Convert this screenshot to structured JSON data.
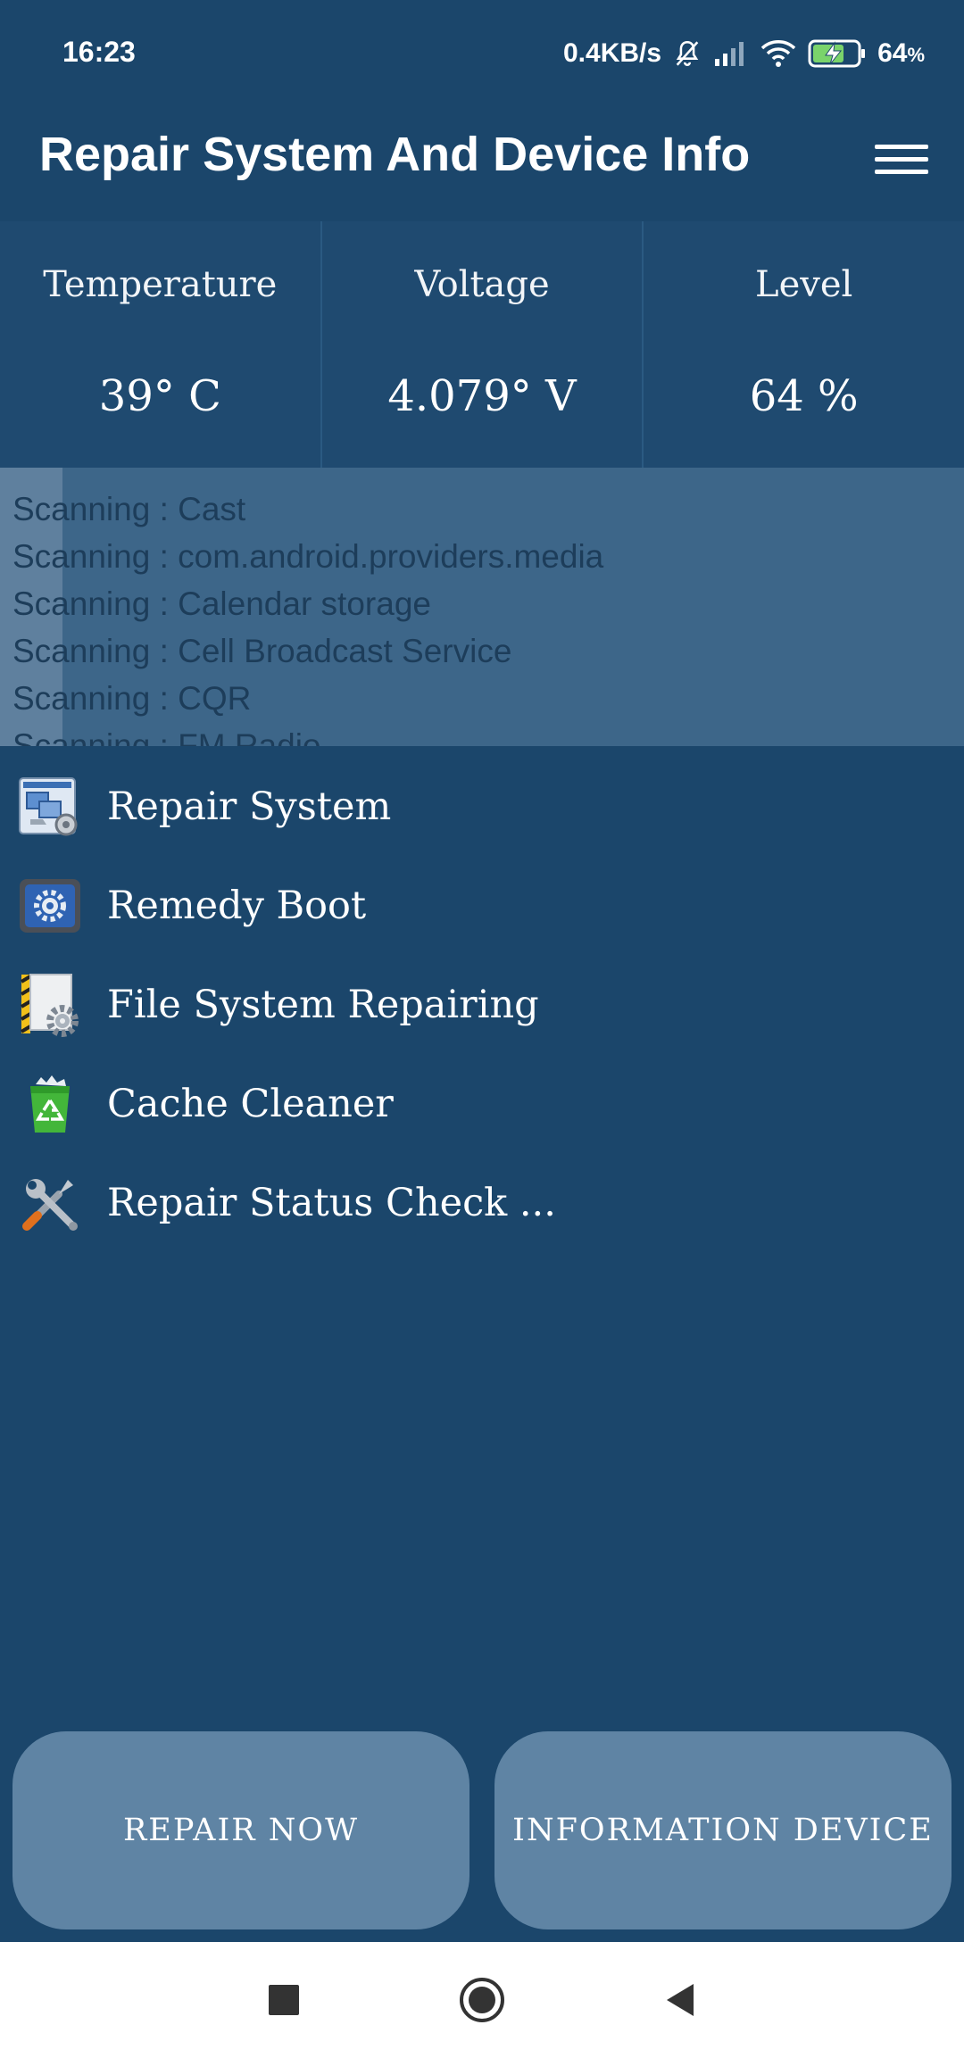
{
  "status_bar": {
    "time": "16:23",
    "net_speed": "0.4KB/s",
    "battery_percent": "64",
    "battery_unit": "%",
    "icons": [
      "bell-off-icon",
      "signal-icon",
      "wifi-icon",
      "battery-charging-icon"
    ]
  },
  "app_bar": {
    "title": "Repair System And Device Info",
    "menu_icon": "hamburger-menu-icon"
  },
  "stats": {
    "temperature": {
      "label": "Temperature",
      "value": "39° C"
    },
    "voltage": {
      "label": "Voltage",
      "value": "4.079° V"
    },
    "level": {
      "label": "Level",
      "value": "64 %"
    }
  },
  "scan_log": {
    "lines": [
      "Scanning : Cast",
      "Scanning : com.android.providers.media",
      "Scanning : Calendar storage",
      "Scanning : Cell Broadcast Service",
      "Scanning : CQR",
      "Scanning : FM Radio"
    ]
  },
  "menu": {
    "items": [
      {
        "label": "Repair System",
        "icon": "repair-system-icon"
      },
      {
        "label": "Remedy Boot",
        "icon": "boot-gear-icon"
      },
      {
        "label": "File System Repairing",
        "icon": "file-gear-icon"
      },
      {
        "label": "Cache Cleaner",
        "icon": "recycle-bin-icon"
      },
      {
        "label": "Repair Status Check ...",
        "icon": "tools-icon"
      }
    ]
  },
  "buttons": {
    "repair_now": "REPAIR NOW",
    "information_device": "INFORMATION DEVICE"
  },
  "nav_bar": {
    "icons": [
      "recents-square-icon",
      "home-circle-icon",
      "back-triangle-icon"
    ]
  },
  "colors": {
    "background": "#1b466b",
    "stats_background": "#1f4a70",
    "scan_background": "#3d6689",
    "button": "#5f84a4"
  }
}
